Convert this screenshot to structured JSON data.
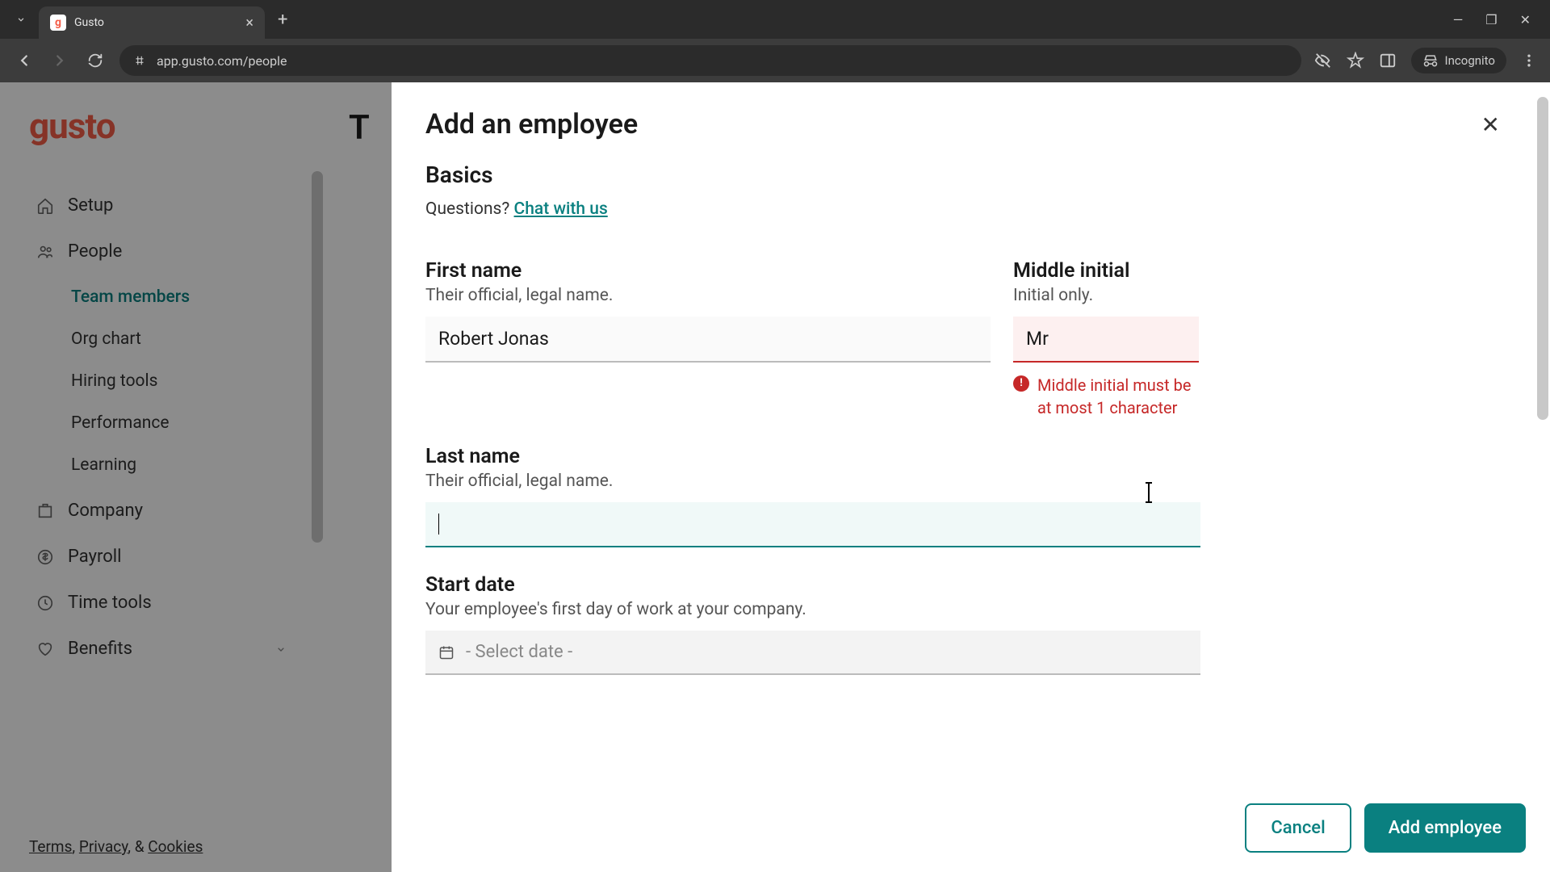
{
  "browser": {
    "tab_title": "Gusto",
    "url": "app.gusto.com/people",
    "incognito_label": "Incognito"
  },
  "sidebar": {
    "logo": "gusto",
    "items": [
      {
        "label": "Setup",
        "icon": "home"
      },
      {
        "label": "People",
        "icon": "people",
        "expanded": true
      },
      {
        "label": "Company",
        "icon": "company"
      },
      {
        "label": "Payroll",
        "icon": "payroll"
      },
      {
        "label": "Time tools",
        "icon": "clock"
      },
      {
        "label": "Benefits",
        "icon": "heart"
      }
    ],
    "people_sub": [
      {
        "label": "Team members",
        "active": true
      },
      {
        "label": "Org chart"
      },
      {
        "label": "Hiring tools"
      },
      {
        "label": "Performance"
      },
      {
        "label": "Learning"
      }
    ],
    "legal_prefix_terms": "Terms",
    "legal_privacy": "Privacy",
    "legal_amp": ", & ",
    "legal_cookies": "Cookies"
  },
  "background_title": "T",
  "modal": {
    "title": "Add an employee",
    "section": "Basics",
    "questions_prefix": "Questions? ",
    "chat_link": "Chat with us",
    "first_name": {
      "label": "First name",
      "hint": "Their official, legal name.",
      "value": "Robert Jonas"
    },
    "middle_initial": {
      "label": "Middle initial",
      "hint": "Initial only.",
      "value": "Mr",
      "error": "Middle initial must be at most 1 character"
    },
    "last_name": {
      "label": "Last name",
      "hint": "Their official, legal name.",
      "value": ""
    },
    "start_date": {
      "label": "Start date",
      "hint": "Your employee's first day of work at your company.",
      "placeholder": "- Select date -"
    },
    "cancel": "Cancel",
    "submit": "Add employee"
  }
}
